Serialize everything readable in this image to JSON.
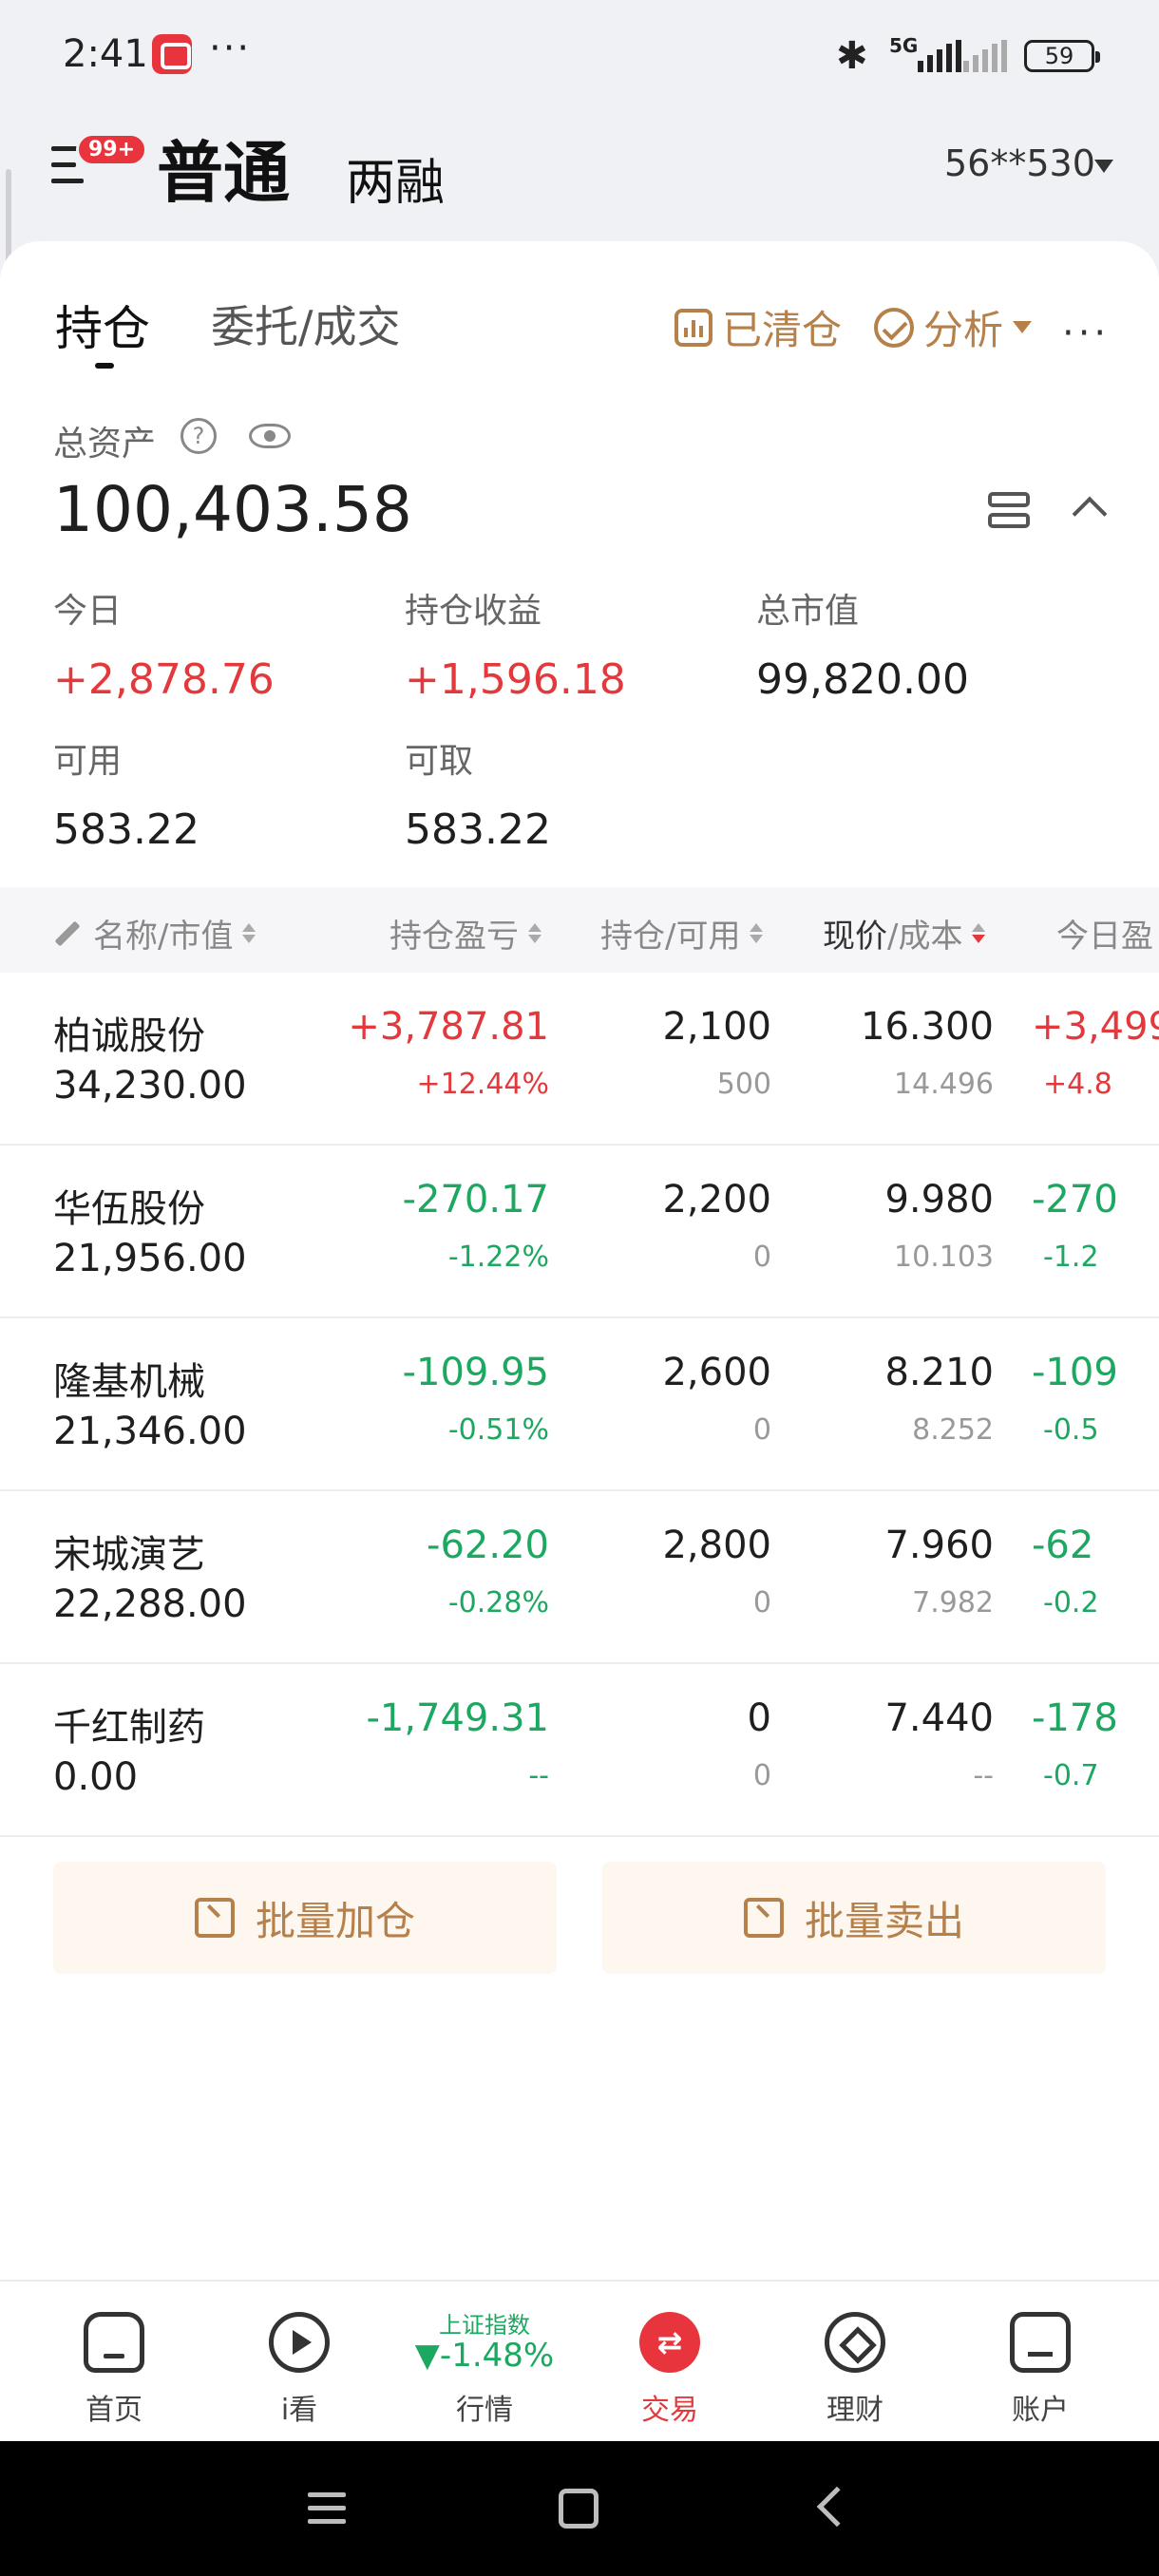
{
  "status_bar": {
    "time": "2:41",
    "dots": "···",
    "network": "5G",
    "battery": "59"
  },
  "header": {
    "badge": "99+",
    "title": "普通",
    "subtitle": "两融",
    "account": "56**530"
  },
  "tabs": {
    "active": "持仓",
    "other": "委托/成交"
  },
  "toolbar": {
    "cleared": "已清仓",
    "analysis": "分析",
    "more": "···"
  },
  "assets": {
    "label": "总资产",
    "help": "?",
    "value": "100,403.58",
    "today_label": "今日",
    "today_value": "+2,878.76",
    "pnl_label": "持仓收益",
    "pnl_value": "+1,596.18",
    "mv_label": "总市值",
    "mv_value": "99,820.00",
    "avail_label": "可用",
    "avail_value": "583.22",
    "withdraw_label": "可取",
    "withdraw_value": "583.22"
  },
  "table": {
    "headers": {
      "name": "名称/市值",
      "pnl": "持仓盈亏",
      "qty": "持仓/可用",
      "price_a": "现价",
      "price_b": "/成本",
      "today": "今日盈"
    },
    "rows": [
      {
        "name": "柏诚股份",
        "mv": "34,230.00",
        "pnl": "+3,787.81",
        "pnl_pct": "+12.44%",
        "qty": "2,100",
        "avail": "500",
        "price": "16.300",
        "cost": "14.496",
        "today": "+3,499",
        "today_pct": "+4.8",
        "color": "red"
      },
      {
        "name": "华伍股份",
        "mv": "21,956.00",
        "pnl": "-270.17",
        "pnl_pct": "-1.22%",
        "qty": "2,200",
        "avail": "0",
        "price": "9.980",
        "cost": "10.103",
        "today": "-270",
        "today_pct": "-1.2",
        "color": "green"
      },
      {
        "name": "隆基机械",
        "mv": "21,346.00",
        "pnl": "-109.95",
        "pnl_pct": "-0.51%",
        "qty": "2,600",
        "avail": "0",
        "price": "8.210",
        "cost": "8.252",
        "today": "-109",
        "today_pct": "-0.5",
        "color": "green"
      },
      {
        "name": "宋城演艺",
        "mv": "22,288.00",
        "pnl": "-62.20",
        "pnl_pct": "-0.28%",
        "qty": "2,800",
        "avail": "0",
        "price": "7.960",
        "cost": "7.982",
        "today": "-62",
        "today_pct": "-0.2",
        "color": "green"
      },
      {
        "name": "千红制药",
        "mv": "0.00",
        "pnl": "-1,749.31",
        "pnl_pct": "--",
        "qty": "0",
        "avail": "0",
        "price": "7.440",
        "cost": "--",
        "today": "-178",
        "today_pct": "-0.7",
        "color": "green"
      }
    ]
  },
  "batch": {
    "add": "批量加仓",
    "sell": "批量卖出"
  },
  "bottom_nav": {
    "home": "首页",
    "watch": "i看",
    "index_name": "上证指数",
    "index_value": "▼-1.48%",
    "market": "行情",
    "trade": "交易",
    "wealth": "理财",
    "account": "账户"
  },
  "colors": {
    "red": "#E4393C",
    "green": "#1DA861",
    "accent": "#B6804A",
    "trade": "#E8343C"
  }
}
